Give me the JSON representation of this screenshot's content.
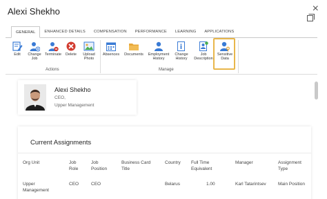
{
  "window": {
    "title": "Alexi Shekho",
    "close_glyph": "×"
  },
  "ribbon": {
    "tabs": [
      {
        "label": "GENERAL",
        "active": true
      },
      {
        "label": "ENHANCED DETAILS",
        "active": false
      },
      {
        "label": "COMPENSATION",
        "active": false
      },
      {
        "label": "PERFORMANCE",
        "active": false
      },
      {
        "label": "LEARNING",
        "active": false
      },
      {
        "label": "APPLICATIONS",
        "active": false
      }
    ],
    "groups": {
      "actions": "Actions",
      "manage": "Manage"
    },
    "tools": [
      {
        "label1": "Edit",
        "label2": "",
        "icon": "edit-icon"
      },
      {
        "label1": "Change",
        "label2": "Job",
        "icon": "change-job-icon"
      },
      {
        "label1": "Terminate",
        "label2": "",
        "icon": "terminate-icon"
      },
      {
        "label1": "Delete",
        "label2": "",
        "icon": "delete-icon"
      },
      {
        "label1": "Upload",
        "label2": "Photo",
        "icon": "upload-photo-icon"
      },
      {
        "label1": "Absences",
        "label2": "",
        "icon": "absences-icon"
      },
      {
        "label1": "Documents",
        "label2": "",
        "icon": "folder-icon"
      },
      {
        "label1": "Employment",
        "label2": "History",
        "icon": "employment-history-icon"
      },
      {
        "label1": "Change",
        "label2": "History",
        "icon": "change-history-icon"
      },
      {
        "label1": "Job",
        "label2": "Description",
        "icon": "job-description-icon"
      },
      {
        "label1": "Sensitive",
        "label2": "Data",
        "icon": "sensitive-data-icon"
      }
    ],
    "highlight_color": "#e8b64a"
  },
  "profile": {
    "name": "Alexi Shekho",
    "role": "CEO,",
    "department": "Upper Management"
  },
  "assignments": {
    "title": "Current Assignments",
    "headers": [
      [
        "Org Unit",
        ""
      ],
      [
        "Job",
        "Role"
      ],
      [
        "Job",
        "Position"
      ],
      [
        "Business Card",
        "Title"
      ],
      [
        "Country",
        ""
      ],
      [
        "Full Time",
        "Equivalent"
      ],
      [
        "Manager",
        ""
      ],
      [
        "Assignment",
        "Type"
      ]
    ],
    "rows": [
      [
        [
          "Upper",
          "Management"
        ],
        [
          "CEO",
          ""
        ],
        [
          "CEO",
          ""
        ],
        [
          "",
          ""
        ],
        [
          "Belarus",
          ""
        ],
        [
          "1.00",
          ""
        ],
        [
          "Karl Tatarintsev",
          ""
        ],
        [
          "Main Position",
          ""
        ]
      ]
    ]
  },
  "colors": {
    "icon_blue": "#3a7bd5",
    "icon_red": "#d23b2f",
    "folder_yellow": "#e8a83a"
  }
}
